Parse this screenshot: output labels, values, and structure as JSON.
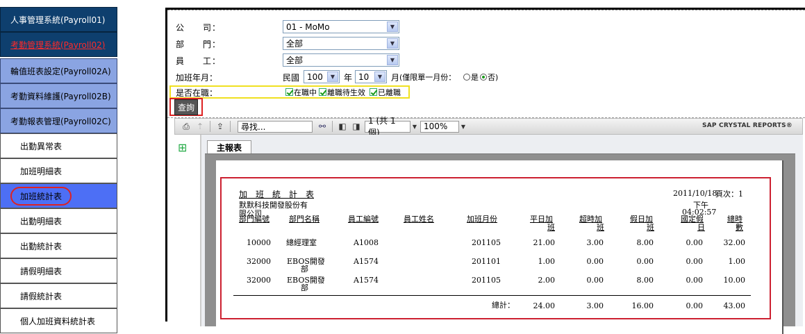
{
  "nav": {
    "systems": [
      {
        "label": "人事管理系統(Payroll01)"
      },
      {
        "label": "考勤管理系統(Payroll02)"
      }
    ],
    "groups": [
      {
        "label": "輪值班表設定(Payroll02A)"
      },
      {
        "label": "考勤資料維護(Payroll02B)"
      },
      {
        "label": "考勤報表管理(Payroll02C)"
      }
    ],
    "items": [
      {
        "label": "出勤異常表"
      },
      {
        "label": "加班明細表"
      },
      {
        "label": "加班統計表"
      },
      {
        "label": "出勤明細表"
      },
      {
        "label": "出勤統計表"
      },
      {
        "label": "請假明細表"
      },
      {
        "label": "請假統計表"
      },
      {
        "label": "個人加班資料統計表"
      }
    ]
  },
  "form": {
    "company_label": "公　　司：",
    "company_value": "01 - MoMo",
    "dept_label": "部　　門：",
    "dept_value": "全部",
    "emp_label": "員　　工：",
    "emp_value": "全部",
    "ym_label": "加班年月：",
    "ym_prefix": "民國",
    "year_value": "100",
    "year_unit": "年",
    "month_value": "10",
    "month_unit": "月",
    "single_month_label": "(僅限單一月份：",
    "yes_label": "是",
    "no_label": "否)",
    "status_label": "是否在職：",
    "status_opts": [
      "在職中",
      "離職待生效",
      "已離職"
    ],
    "query_button": "查詢"
  },
  "toolbar": {
    "search_value": "尋找...",
    "page_value": "1 (共 1 個)",
    "zoom_value": "100%",
    "brand": "SAP CRYSTAL REPORTS®"
  },
  "viewer": {
    "tab_label": "主報表"
  },
  "report": {
    "title": "加　班　統　計　表",
    "company_line1": "默默科技開發股份有",
    "company_line2": "限公司",
    "date": "2011/10/18",
    "page_label": "頁次：1",
    "time_line1": "下午",
    "time_line2": "04:02:57",
    "headers": {
      "dept_no": "部門編號",
      "dept_name": "部門名稱",
      "emp_no": "員工編號",
      "emp_name": "員工姓名",
      "ym": "加班月份",
      "weekday1": "平日加",
      "weekday2": "班",
      "over1": "超時加",
      "over2": "班",
      "holiday1": "假日加",
      "holiday2": "班",
      "national1": "國定假",
      "national2": "日",
      "total1": "總時",
      "total2": "數"
    },
    "rows": [
      {
        "dept_no": "10000",
        "dept_name1": "總經理室",
        "dept_name2": "",
        "emp_no": "A1008",
        "emp_name": "",
        "ym": "201105",
        "weekday": "21.00",
        "over": "3.00",
        "holiday": "8.00",
        "national": "0.00",
        "total": "32.00"
      },
      {
        "dept_no": "32000",
        "dept_name1": "EBOS開發",
        "dept_name2": "部",
        "emp_no": "A1574",
        "emp_name": "",
        "ym": "201101",
        "weekday": "1.00",
        "over": "0.00",
        "holiday": "0.00",
        "national": "0.00",
        "total": "1.00"
      },
      {
        "dept_no": "32000",
        "dept_name1": "EBOS開發",
        "dept_name2": "部",
        "emp_no": "A1574",
        "emp_name": "",
        "ym": "201105",
        "weekday": "2.00",
        "over": "0.00",
        "holiday": "8.00",
        "national": "0.00",
        "total": "10.00"
      }
    ],
    "totals": {
      "label": "總計：",
      "weekday": "24.00",
      "over": "3.00",
      "holiday": "16.00",
      "national": "0.00",
      "total": "43.00"
    }
  }
}
